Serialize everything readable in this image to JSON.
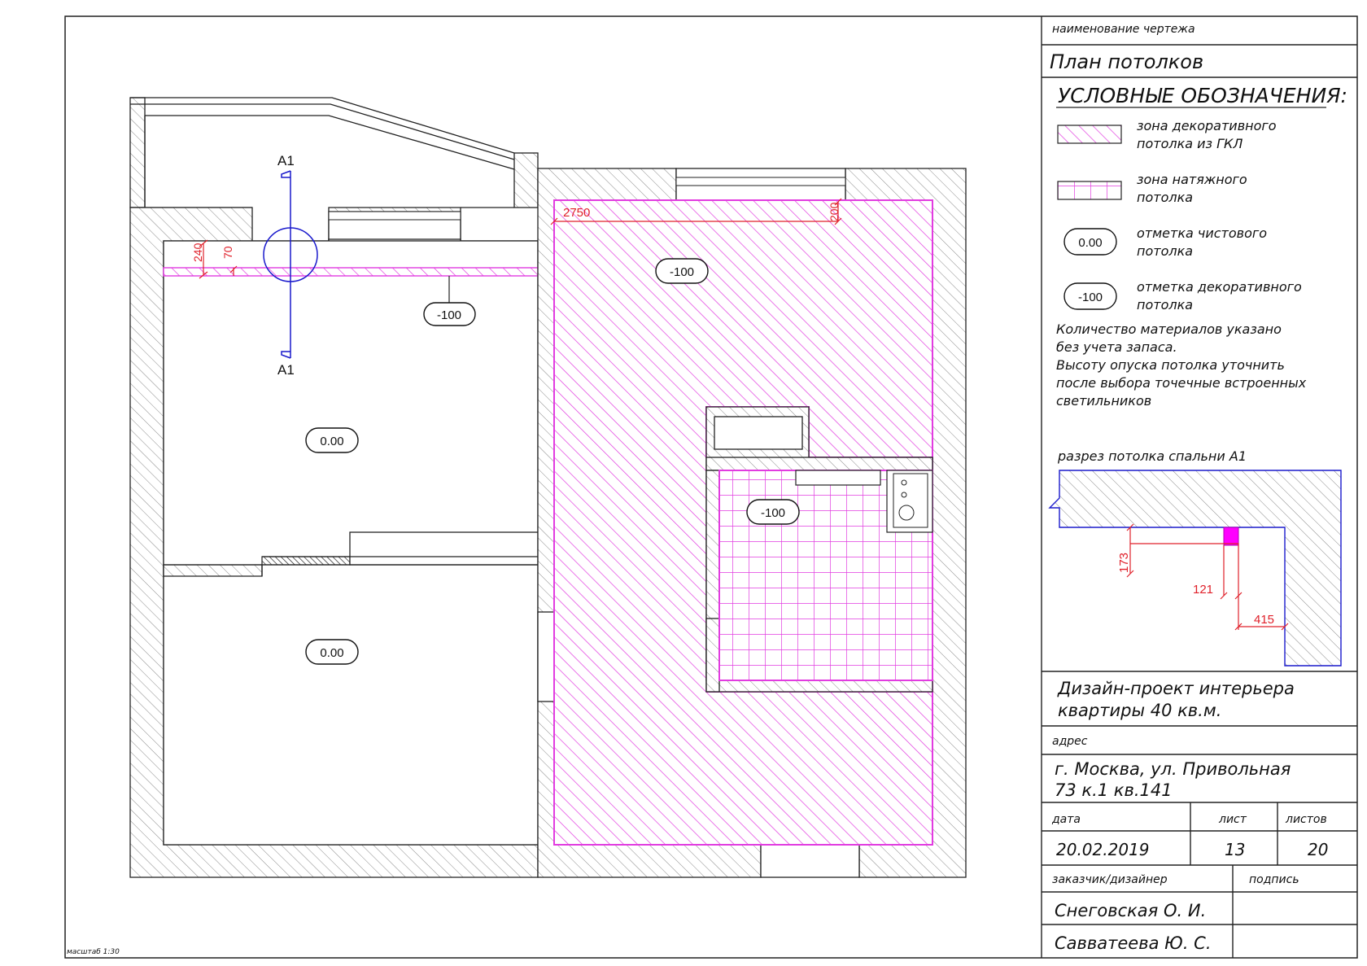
{
  "title_block": {
    "drawing_name_caption": "наименование чертежа",
    "drawing_name": "План потолков",
    "project_title_1": "Дизайн-проект интерьера",
    "project_title_2": "квартиры 40 кв.м.",
    "address_caption": "адрес",
    "address_1": "г. Москва, ул. Привольная",
    "address_2": "73 к.1 кв.141",
    "date_caption": "дата",
    "sheet_caption": "лист",
    "sheets_caption": "листов",
    "date": "20.02.2019",
    "sheet": "13",
    "sheets": "20",
    "client_caption": "заказчик/дизайнер",
    "signature_caption": "подпись",
    "client": "Снеговская О. И.",
    "designer": "Савватеева Ю. С."
  },
  "legend": {
    "heading": "УСЛОВНЫЕ ОБОЗНАЧЕНИЯ:",
    "items": [
      {
        "line1": "зона декоративного",
        "line2": "потолка из ГКЛ"
      },
      {
        "line1": "зона натяжного",
        "line2": "потолка"
      },
      {
        "badge": "0.00",
        "line1": "отметка чистового",
        "line2": "потолка"
      },
      {
        "badge": "-100",
        "line1": "отметка декоративного",
        "line2": "потолка"
      }
    ],
    "notes": [
      "Количество материалов указано",
      "без учета запаса.",
      "Высоту опуска потолка уточнить",
      "после выбора точечные встроенных",
      "светильников"
    ]
  },
  "section": {
    "caption": "разрез потолка спальни А1",
    "dim_vertical": "173",
    "dim_inner": "121",
    "dim_outer": "415"
  },
  "plan": {
    "section_mark_top": "А1",
    "section_mark_bottom": "А1",
    "dim_240": "240",
    "dim_70": "70",
    "dim_2750": "2750",
    "dim_200": "200",
    "level_bedroom_strip": "-100",
    "level_room1": "0.00",
    "level_room2": "0.00",
    "level_kitchen": "-100",
    "level_bath": "-100"
  },
  "scale_note": "масштаб 1:30",
  "colors": {
    "magenta": "#e23ce0",
    "dimension_red": "#e0202a",
    "section_blue": "#1a1acc"
  }
}
